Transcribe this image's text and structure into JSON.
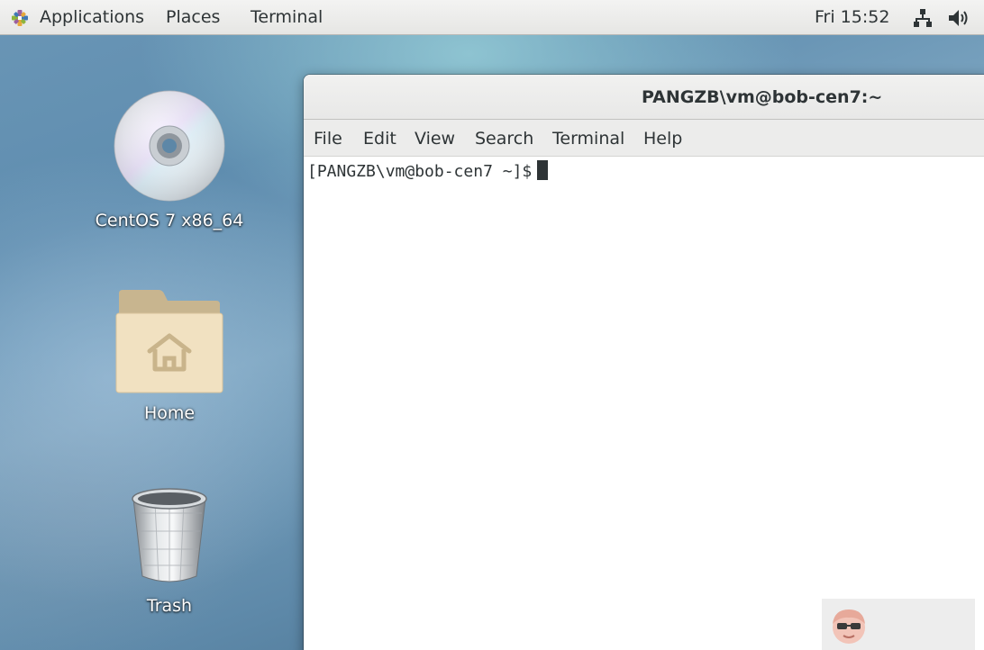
{
  "topbar": {
    "applications_label": "Applications",
    "places_label": "Places",
    "terminal_label": "Terminal",
    "clock": "Fri 15:52",
    "network_icon": "network-icon",
    "volume_icon": "volume-icon"
  },
  "desktop": {
    "icons": [
      {
        "label": "CentOS 7 x86_64",
        "icon": "disc-icon"
      },
      {
        "label": "Home",
        "icon": "home-folder-icon"
      },
      {
        "label": "Trash",
        "icon": "trash-icon"
      }
    ]
  },
  "terminal_window": {
    "title": "PANGZB\\vm@bob-cen7:~",
    "menu": [
      "File",
      "Edit",
      "View",
      "Search",
      "Terminal",
      "Help"
    ],
    "prompt": "[PANGZB\\vm@bob-cen7 ~]$"
  },
  "colors": {
    "panel_bg": "#ececeb",
    "text": "#2e3436",
    "terminal_bg": "#ffffff"
  }
}
